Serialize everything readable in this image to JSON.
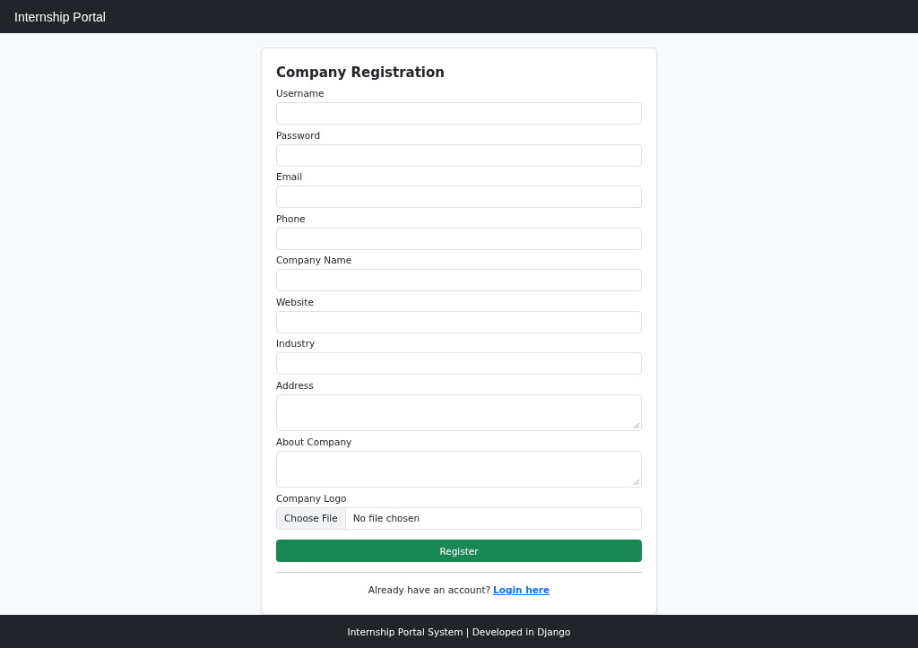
{
  "navbar": {
    "brand": "Internship Portal"
  },
  "form": {
    "title": "Company Registration",
    "fields": [
      {
        "label": "Username",
        "kind": "text"
      },
      {
        "label": "Password",
        "kind": "text"
      },
      {
        "label": "Email",
        "kind": "text"
      },
      {
        "label": "Phone",
        "kind": "text"
      },
      {
        "label": "Company Name",
        "kind": "text"
      },
      {
        "label": "Website",
        "kind": "text"
      },
      {
        "label": "Industry",
        "kind": "text"
      },
      {
        "label": "Address",
        "kind": "textarea"
      },
      {
        "label": "About Company",
        "kind": "textarea"
      },
      {
        "label": "Company Logo",
        "kind": "file",
        "button_label": "Choose File",
        "value": "No file chosen"
      }
    ],
    "submit": "Register",
    "prompt": "Already have an account?",
    "link": "Login here"
  },
  "footer": "Internship Portal System | Developed in Django"
}
